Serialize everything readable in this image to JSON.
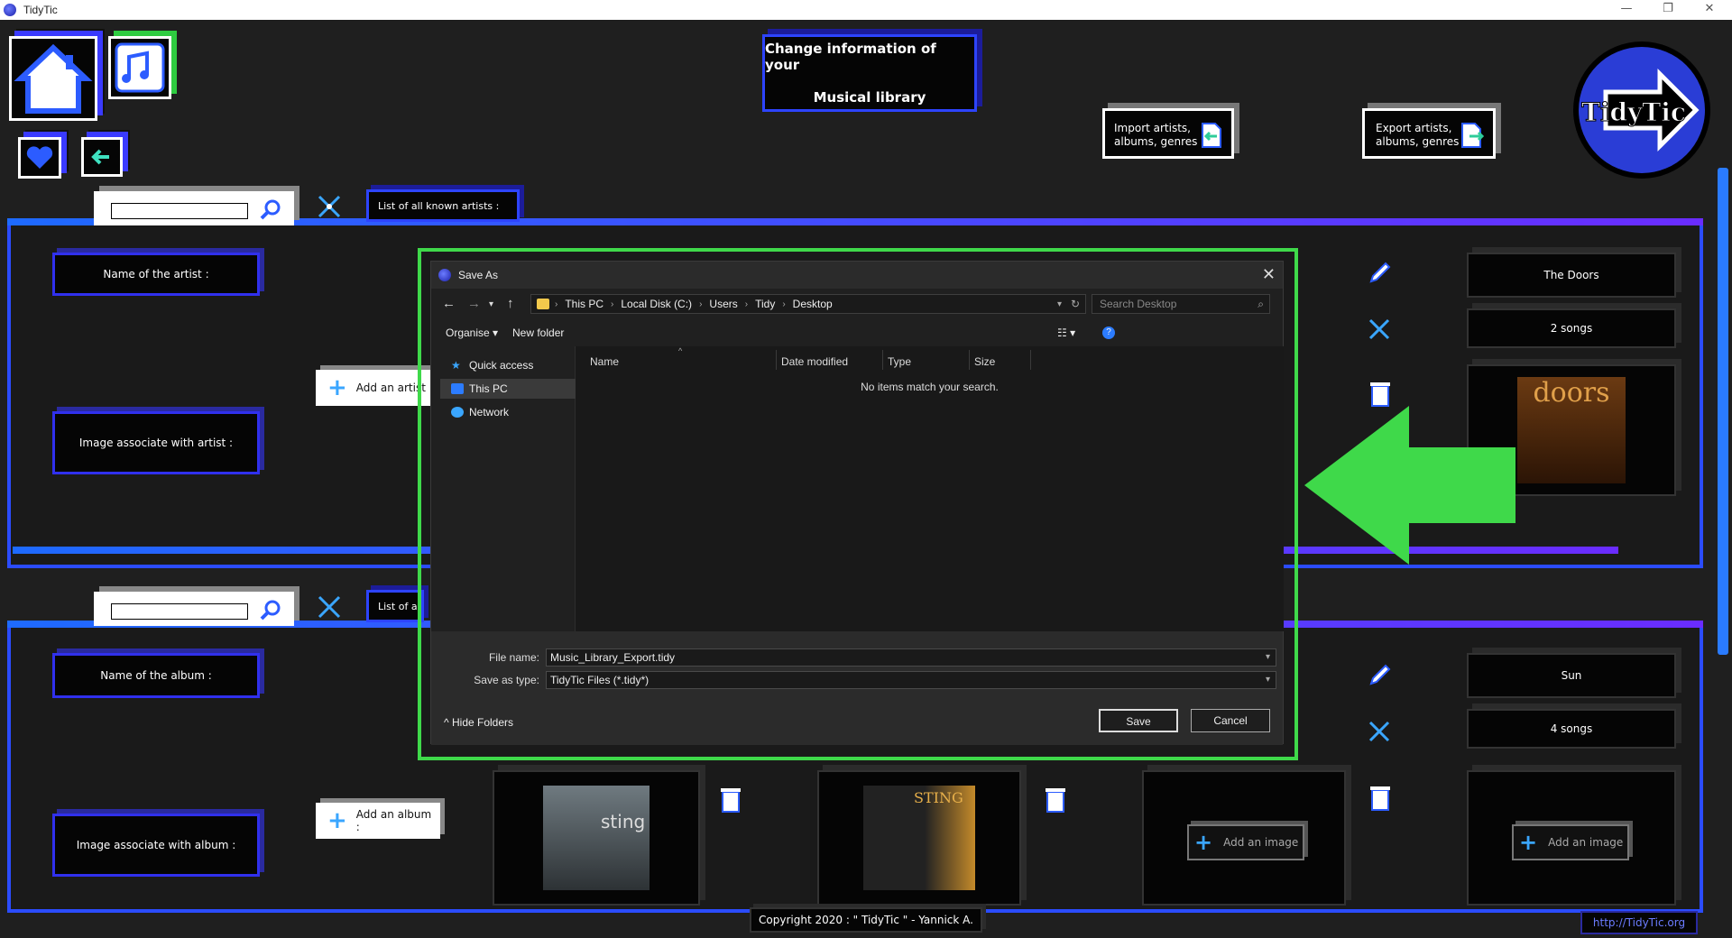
{
  "window": {
    "title": "TidyTic",
    "minimize": "—",
    "restore": "❐",
    "close": "✕"
  },
  "header": {
    "title_line1": "Change information of your",
    "title_line2": "Musical library",
    "import_label_line1": "Import artists,",
    "import_label_line2": "albums, genres",
    "export_label_line1": "Export artists,",
    "export_label_line2": "albums, genres",
    "logo_text": "TidyTic"
  },
  "artists_section": {
    "list_label": "List of all known artists :",
    "name_label": "Name of the artist :",
    "image_label": "Image associate with artist :",
    "add_button": "Add an artist",
    "card": {
      "name": "The Doors",
      "songs": "2 songs",
      "album_art_text": "doors"
    }
  },
  "albums_section": {
    "list_label": "List of all known albums :",
    "name_label": "Name of the album :",
    "image_label": "Image associate with album :",
    "add_button": "Add an album :",
    "card": {
      "name": "Sun",
      "songs": "4 songs"
    },
    "add_image_1": "Add an image",
    "add_image_2": "Add an image",
    "cover_1_text": "sting",
    "cover_2_text": "STING"
  },
  "dialog": {
    "title": "Save As",
    "path": [
      "This PC",
      "Local Disk (C:)",
      "Users",
      "Tidy",
      "Desktop"
    ],
    "search_placeholder": "Search Desktop",
    "organise": "Organise",
    "new_folder": "New folder",
    "nav": {
      "quick_access": "Quick access",
      "this_pc": "This PC",
      "network": "Network"
    },
    "columns": [
      "Name",
      "Date modified",
      "Type",
      "Size"
    ],
    "empty_message": "No items match your search.",
    "file_name_label": "File name:",
    "file_name_value": "Music_Library_Export.tidy",
    "save_type_label": "Save as type:",
    "save_type_value": "TidyTic Files (*.tidy*)",
    "save_button": "Save",
    "cancel_button": "Cancel",
    "hide_folders": "Hide Folders"
  },
  "footer": {
    "copyright": "Copyright 2020 : \" TidyTic \" - Yannick A.",
    "link": "http://TidyTic.org"
  },
  "colors": {
    "accent_blue": "#2d44ff",
    "highlight_green": "#3fd94a",
    "background": "#1f1f1f"
  }
}
